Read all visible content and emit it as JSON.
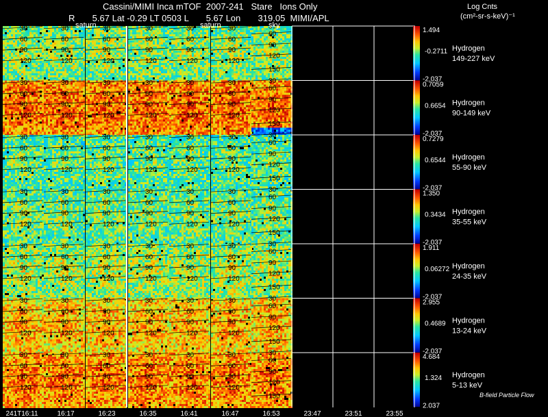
{
  "header": {
    "title": "Cassini/MIMI Inca mTOF  2007-241   Stare   Ions Only",
    "subtitle": "R       5.67 Lat -0.29 LT 0503 L       5.67 Lon       319.05  MIMI/APL",
    "units_line1": "Log Cnts",
    "units_line2": "(cm²-sr-s-keV)⁻¹"
  },
  "grid": {
    "saturn_labels": [
      "saturn",
      "saturn"
    ],
    "sky_label": "sky",
    "lat_labels": [
      "30",
      "60",
      "90",
      "120",
      "150"
    ]
  },
  "chart_data": {
    "type": "heatmap",
    "title": "Cassini/MIMI Inca mTOF  2007-241   Stare   Ions Only",
    "colorbar_label": "Log Cnts (cm²-sr-s-keV)⁻¹",
    "x_tick_labels": [
      "241T16:11",
      "16:17",
      "16:23",
      "16:35",
      "16:41",
      "16:47",
      "16:53",
      "23:47",
      "23:51",
      "23:55"
    ],
    "panels": [
      {
        "species": "Hydrogen",
        "energy": "149-227 keV",
        "cbar_max": "1.494",
        "cbar_mid": "-0.2711",
        "cbar_min": "-2.037"
      },
      {
        "species": "Hydrogen",
        "energy": "90-149 keV",
        "cbar_max": "0.7059",
        "cbar_mid": "0.6654",
        "cbar_min": "-2.037"
      },
      {
        "species": "Hydrogen",
        "energy": "55-90 keV",
        "cbar_max": "0.7279",
        "cbar_mid": "0.6544",
        "cbar_min": "-2.037"
      },
      {
        "species": "Hydrogen",
        "energy": "35-55 keV",
        "cbar_max": "1.350",
        "cbar_mid": "0.3434",
        "cbar_min": "-2.037"
      },
      {
        "species": "Hydrogen",
        "energy": "24-35 keV",
        "cbar_max": "1.911",
        "cbar_mid": "0.06272",
        "cbar_min": "-2.037"
      },
      {
        "species": "Hydrogen",
        "energy": "13-24 keV",
        "cbar_max": "2.955",
        "cbar_mid": "0.4689",
        "cbar_min": "-2.037"
      },
      {
        "species": "Hydrogen",
        "energy": "5-13 keV",
        "cbar_max": "4.684",
        "cbar_mid": "1.324",
        "cbar_min": "2.037"
      }
    ]
  },
  "footer": {
    "note": "B-field Particle Flow"
  }
}
